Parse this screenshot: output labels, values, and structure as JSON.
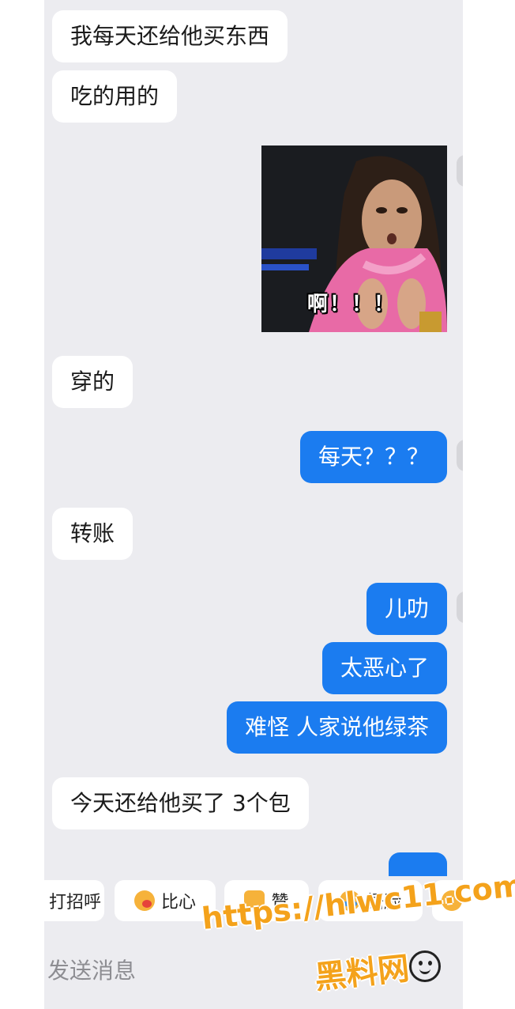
{
  "messages": [
    {
      "side": "in",
      "text": "我每天还给他买东西"
    },
    {
      "side": "in",
      "text": "吃的用的"
    },
    {
      "side": "out",
      "type": "sticker",
      "caption": "啊！！！"
    },
    {
      "side": "in",
      "text": "穿的"
    },
    {
      "side": "out",
      "text": "每天？？？"
    },
    {
      "side": "in",
      "text": "转账"
    },
    {
      "side": "out",
      "text": "儿叻"
    },
    {
      "side": "out",
      "text": "太恶心了"
    },
    {
      "side": "out",
      "text": "难怪 人家说他绿茶"
    },
    {
      "side": "in",
      "text": "今天还给他买了 3个包"
    }
  ],
  "quick_replies": [
    {
      "label": "打招呼",
      "icon": "wave-icon"
    },
    {
      "label": "比心",
      "icon": "heart-hands-icon"
    },
    {
      "label": "赞",
      "icon": "thumbs-up-icon"
    },
    {
      "label": "捂脸",
      "icon": "facepalm-icon"
    }
  ],
  "input": {
    "placeholder": "发送消息"
  },
  "watermark": {
    "url": "https://hlwc11.com",
    "name": "黑料网"
  },
  "colors": {
    "outgoing_bubble": "#1b7cf0",
    "incoming_bubble": "#ffffff",
    "background": "#ececf0",
    "watermark": "#f4a21b"
  }
}
